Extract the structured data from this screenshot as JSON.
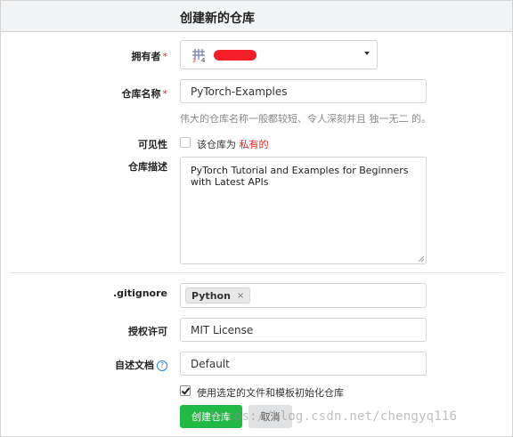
{
  "header": {
    "title": "创建新的仓库"
  },
  "owner": {
    "label": "拥有者",
    "required_mark": "*",
    "icon": "grid-avatar-icon",
    "redacted_color": "#f21f28"
  },
  "repo_name": {
    "label": "仓库名称",
    "required_mark": "*",
    "value": "PyTorch-Examples",
    "help": "伟大的仓库名称一般都较短、令人深刻并且 独一无二 的。"
  },
  "visibility": {
    "label": "可见性",
    "checkbox_label": "该仓库为",
    "private_label": "私有的",
    "checked": false
  },
  "description": {
    "label": "仓库描述",
    "value": "PyTorch Tutorial and Examples for Beginners with Latest APIs"
  },
  "gitignore": {
    "label": ".gitignore",
    "tag": "Python",
    "remove": "×"
  },
  "license": {
    "label": "授权许可",
    "value": "MIT License"
  },
  "readme": {
    "label": "自述文档",
    "help_icon": "?",
    "value": "Default"
  },
  "auto_init": {
    "label": "使用选定的文件和模板初始化仓库",
    "checked": true
  },
  "actions": {
    "create": "创建仓库",
    "cancel": "取消"
  },
  "watermark": "https://blog.csdn.net/chengyq116",
  "colors": {
    "primary": "#21ba45",
    "required": "#db2828",
    "header_bg": "#f3f4f5"
  }
}
